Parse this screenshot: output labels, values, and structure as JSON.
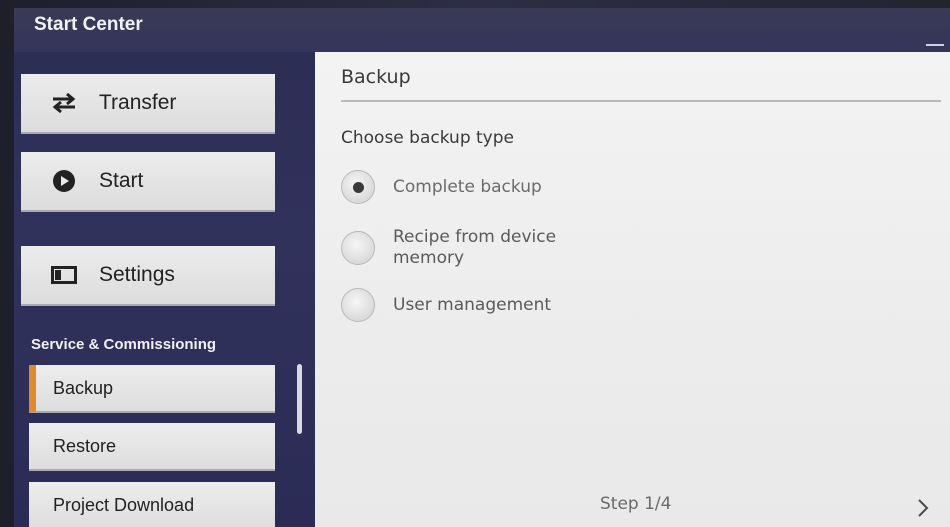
{
  "window": {
    "title": "Start Center",
    "minimize_icon": "minimize-icon"
  },
  "sidebar": {
    "main_buttons": [
      {
        "label": "Transfer",
        "icon": "transfer-arrows-icon"
      },
      {
        "label": "Start",
        "icon": "play-circle-icon"
      },
      {
        "label": "Settings",
        "icon": "settings-panel-icon"
      }
    ],
    "section_label": "Service & Commissioning",
    "sub_items": [
      {
        "label": "Backup",
        "active": true
      },
      {
        "label": "Restore",
        "active": false
      },
      {
        "label": "Project Download",
        "active": false
      }
    ],
    "accent_color": "#e0892e"
  },
  "main": {
    "title": "Backup",
    "prompt": "Choose backup type",
    "options": [
      {
        "label": "Complete backup",
        "selected": true
      },
      {
        "label": "Recipe from device memory",
        "selected": false
      },
      {
        "label": "User management",
        "selected": false
      }
    ],
    "step": "Step 1/4",
    "next_icon": "chevron-right-icon"
  }
}
